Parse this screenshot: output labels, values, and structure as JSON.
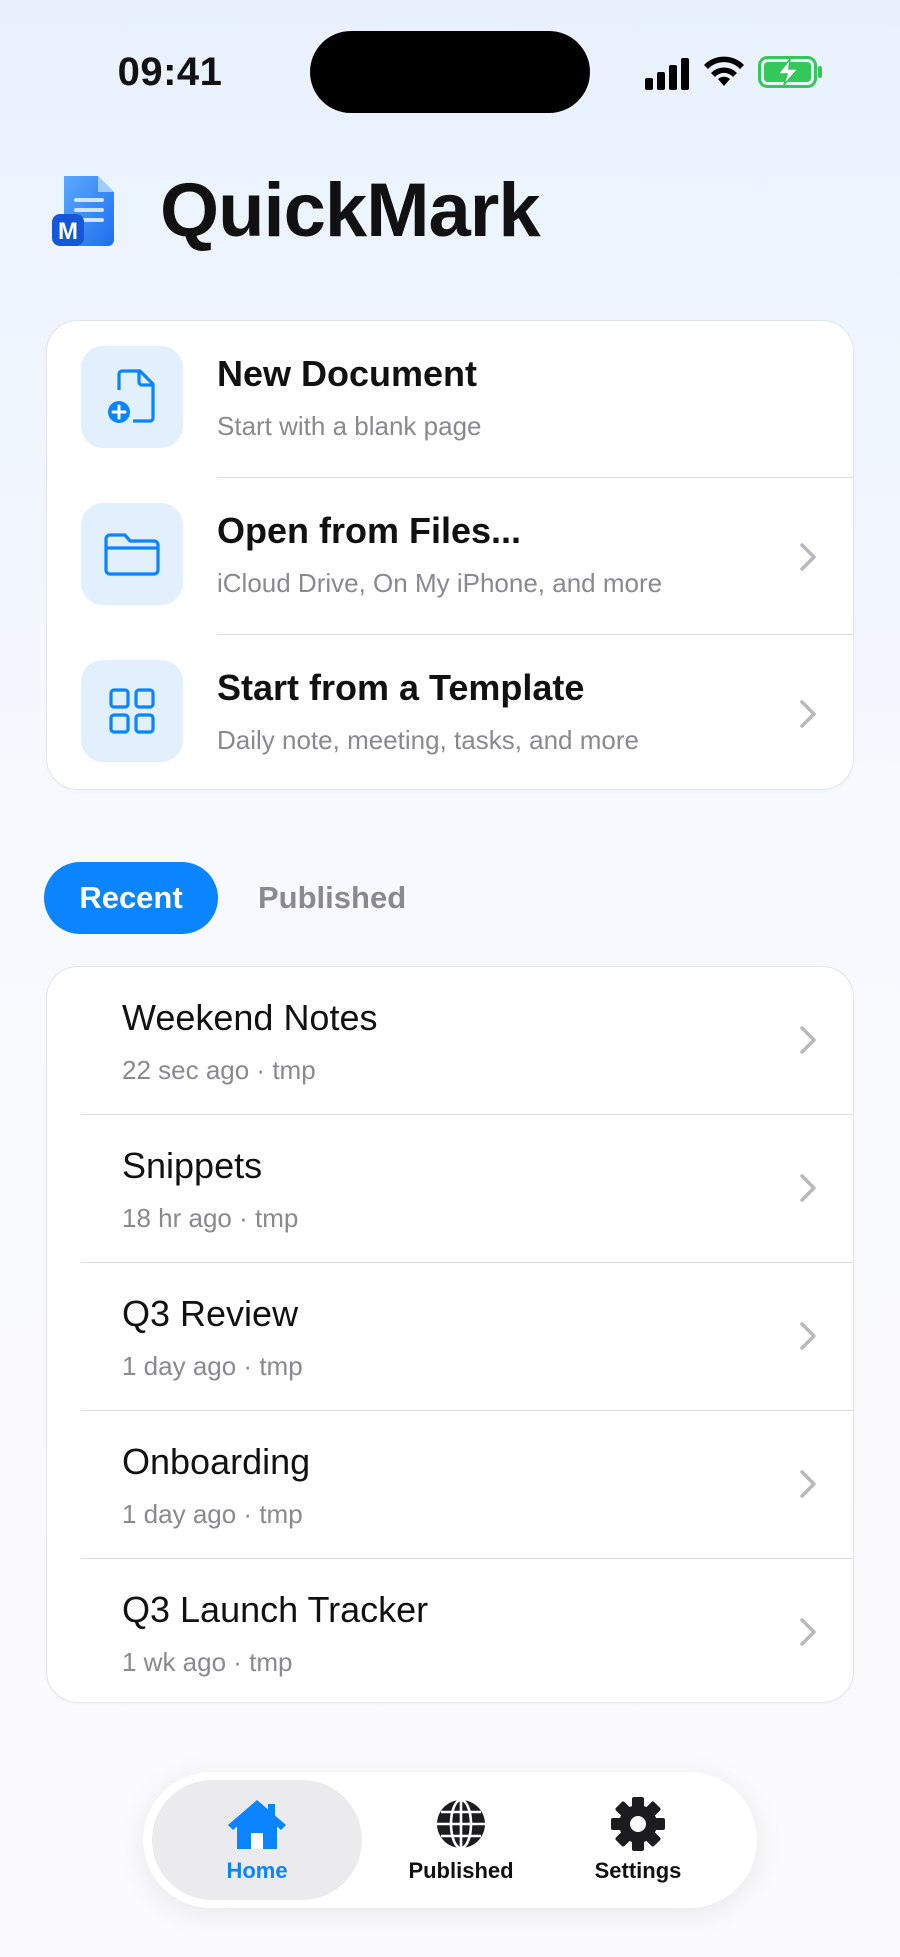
{
  "status_bar": {
    "time": "09:41"
  },
  "header": {
    "app_title": "QuickMark",
    "logo_icon": "quickmark-logo",
    "logo_letter": "M"
  },
  "actions": [
    {
      "title": "New Document",
      "subtitle": "Start with a blank page",
      "icon": "new-document-icon",
      "has_chevron": false
    },
    {
      "title": "Open from Files...",
      "subtitle": "iCloud Drive, On My iPhone, and more",
      "icon": "folder-icon",
      "has_chevron": true
    },
    {
      "title": "Start from a Template",
      "subtitle": "Daily note, meeting, tasks, and more",
      "icon": "grid-icon",
      "has_chevron": true
    }
  ],
  "tabs": {
    "active": "Recent",
    "inactive": "Published"
  },
  "recent": [
    {
      "title": "Weekend Notes",
      "meta": "22 sec ago · tmp"
    },
    {
      "title": "Snippets",
      "meta": "18 hr ago · tmp"
    },
    {
      "title": "Q3 Review",
      "meta": "1 day ago · tmp"
    },
    {
      "title": "Onboarding",
      "meta": "1 day ago · tmp"
    },
    {
      "title": "Q3 Launch Tracker",
      "meta": "1 wk ago · tmp"
    }
  ],
  "tabbar": [
    {
      "label": "Home",
      "icon": "home-icon",
      "active": true
    },
    {
      "label": "Published",
      "icon": "globe-icon",
      "active": false
    },
    {
      "label": "Settings",
      "icon": "gear-icon",
      "active": false
    }
  ],
  "colors": {
    "accent": "#0a84ff",
    "icon_tile": "#e2f0fd",
    "secondary_text": "#8a8a8e",
    "battery_charging": "#34c759"
  }
}
